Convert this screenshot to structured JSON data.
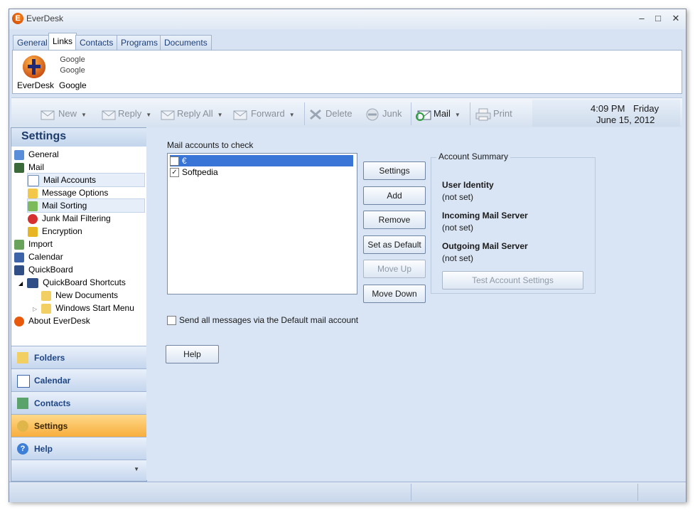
{
  "window": {
    "title": "EverDesk",
    "logo_letter": "E",
    "minimize": "–",
    "maximize": "□",
    "close": "✕"
  },
  "tabs": [
    "General",
    "Links",
    "Contacts",
    "Programs",
    "Documents"
  ],
  "links": [
    {
      "label": "EverDesk",
      "icon": "everdesk-logo-icon"
    },
    {
      "label": "Google",
      "icon_text": [
        "Google",
        "Google"
      ]
    }
  ],
  "toolbar": {
    "new": "New",
    "reply": "Reply",
    "reply_all": "Reply All",
    "forward": "Forward",
    "delete": "Delete",
    "junk": "Junk",
    "mail": "Mail",
    "print": "Print",
    "time": "4:09 PM",
    "day": "Friday",
    "date": "June 15, 2012"
  },
  "sidebar": {
    "title": "Settings",
    "tree": [
      {
        "label": "General",
        "icon": "general-icon"
      },
      {
        "label": "Mail",
        "icon": "mail-icon"
      },
      {
        "label": "Mail Accounts",
        "icon": "mail-accounts-icon",
        "selected": true
      },
      {
        "label": "Message Options",
        "icon": "message-options-icon"
      },
      {
        "label": "Mail Sorting",
        "icon": "mail-sorting-icon",
        "selected": true
      },
      {
        "label": "Junk Mail Filtering",
        "icon": "junk-filter-icon"
      },
      {
        "label": "Encryption",
        "icon": "lock-icon"
      },
      {
        "label": "Import",
        "icon": "import-icon"
      },
      {
        "label": "Calendar",
        "icon": "calendar-icon"
      },
      {
        "label": "QuickBoard",
        "icon": "quickboard-icon"
      },
      {
        "label": "QuickBoard Shortcuts",
        "icon": "quickboard-icon"
      },
      {
        "label": "New Documents",
        "icon": "folder-icon"
      },
      {
        "label": "Windows Start Menu",
        "icon": "folder-icon"
      },
      {
        "label": "About EverDesk",
        "icon": "everdesk-logo-icon"
      }
    ],
    "nav": [
      "Folders",
      "Calendar",
      "Contacts",
      "Settings",
      "Help"
    ]
  },
  "mail": {
    "accounts_label": "Mail accounts to check",
    "accounts": [
      {
        "name": "€",
        "checked": false,
        "selected": true
      },
      {
        "name": "Softpedia",
        "checked": true,
        "selected": false
      }
    ],
    "buttons": {
      "settings": "Settings",
      "add": "Add",
      "remove": "Remove",
      "set_default": "Set as Default",
      "move_up": "Move Up",
      "move_down": "Move Down",
      "help": "Help",
      "test": "Test Account Settings"
    },
    "send_default_label": "Send all messages via the Default mail account",
    "summary": {
      "title": "Account Summary",
      "user_identity_head": "User Identity",
      "user_identity_val": "(not set)",
      "incoming_head": "Incoming Mail Server",
      "incoming_val": "(not set)",
      "outgoing_head": "Outgoing Mail Server",
      "outgoing_val": "(not set)"
    }
  }
}
